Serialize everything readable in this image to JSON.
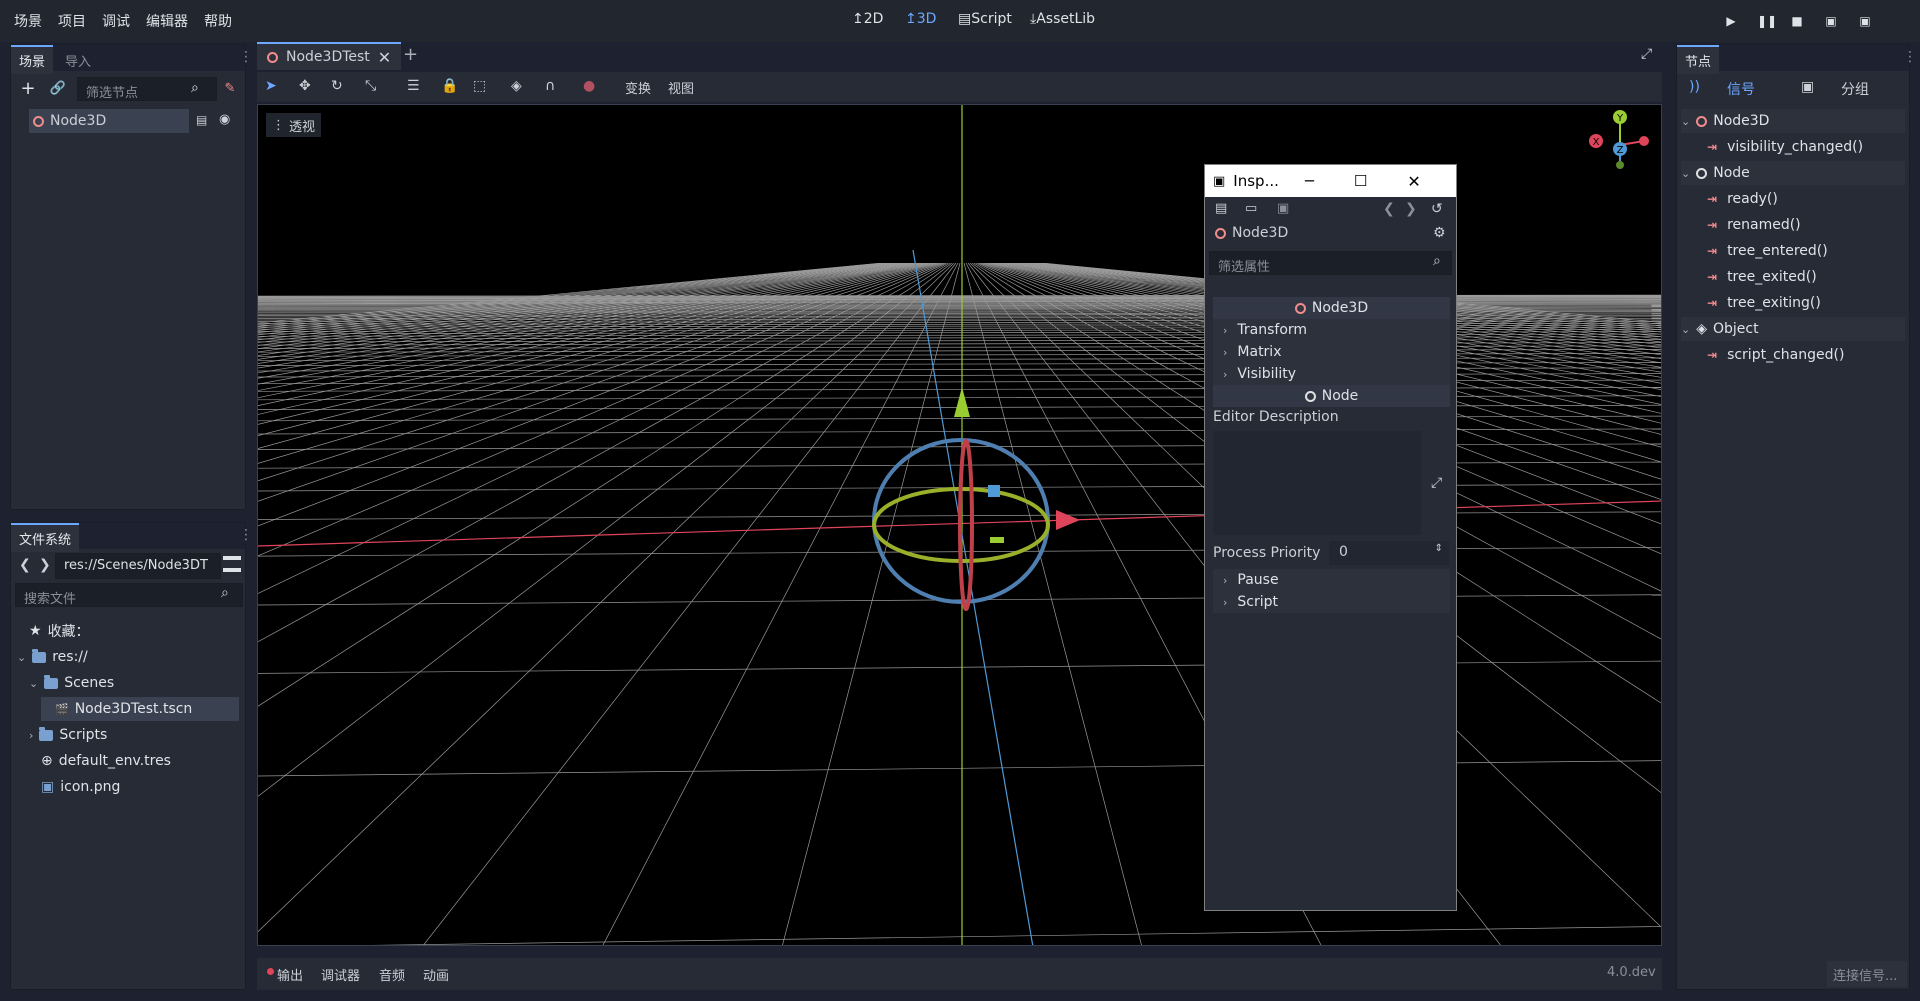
{
  "menu": [
    "场景",
    "项目",
    "调试",
    "编辑器",
    "帮助"
  ],
  "modes": [
    {
      "label": "2D",
      "icon": "2d-icon"
    },
    {
      "label": "3D",
      "icon": "3d-icon"
    },
    {
      "label": "Script",
      "icon": "script-icon"
    },
    {
      "label": "AssetLib",
      "icon": "assetlib-icon"
    }
  ],
  "scene_dock": {
    "tabs": [
      "场景",
      "导入"
    ],
    "filter_placeholder": "筛选节点",
    "root": "Node3D"
  },
  "editor": {
    "tab": "Node3DTest",
    "menus": [
      "变换",
      "视图"
    ],
    "view_label": "透视"
  },
  "gizmo": {
    "y": "Y",
    "x": "X",
    "z": "Z"
  },
  "filesystem": {
    "title": "文件系统",
    "path": "res://Scenes/Node3DT",
    "search_placeholder": "搜索文件",
    "favorites": "收藏：",
    "items": [
      "res://",
      "Scenes",
      "Node3DTest.tscn",
      "Scripts",
      "default_env.tres",
      "icon.png"
    ]
  },
  "inspector": {
    "title": "Insp...",
    "node": "Node3D",
    "filter_placeholder": "筛选属性",
    "header1": "Node3D",
    "sections": [
      "Transform",
      "Matrix",
      "Visibility"
    ],
    "header2": "Node",
    "editor_description": "Editor Description",
    "process_priority_label": "Process Priority",
    "process_priority_value": "0",
    "sections2": [
      "Pause",
      "Script"
    ]
  },
  "node_dock": {
    "title": "节点",
    "tabs": [
      "信号",
      "分组"
    ],
    "groups": [
      {
        "name": "Node3D",
        "signals": [
          "visibility_changed()"
        ]
      },
      {
        "name": "Node",
        "signals": [
          "ready()",
          "renamed()",
          "tree_entered()",
          "tree_exited()",
          "tree_exiting()"
        ]
      },
      {
        "name": "Object",
        "signals": [
          "script_changed()"
        ]
      }
    ],
    "connect_button": "连接信号..."
  },
  "bottom": {
    "tabs": [
      "输出",
      "调试器",
      "音频",
      "动画"
    ],
    "version": "4.0.dev"
  },
  "colors": {
    "accent": "#6ea7ff",
    "signal": "#f28b8b",
    "x_axis": "#e0445b",
    "y_axis": "#9acd32",
    "z_axis": "#4f9ad6"
  }
}
